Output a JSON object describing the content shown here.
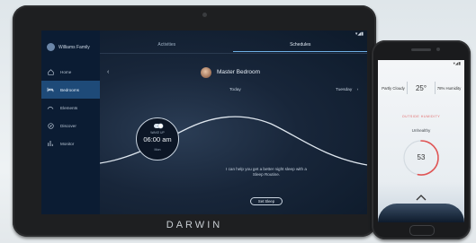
{
  "tablet": {
    "brand": "DARWIN",
    "status": "▾◢▮",
    "sidebar": {
      "profile_name": "Williams Family",
      "items": [
        {
          "label": "Home",
          "icon": "home-icon"
        },
        {
          "label": "Bedrooms",
          "icon": "bed-icon",
          "active": true
        },
        {
          "label": "Elements",
          "icon": "elements-icon"
        },
        {
          "label": "Discover",
          "icon": "discover-icon"
        },
        {
          "label": "Monitor",
          "icon": "monitor-icon"
        }
      ]
    },
    "tabs": [
      {
        "label": "Activities",
        "active": false
      },
      {
        "label": "Schedules",
        "active": true
      }
    ],
    "back_glyph": "‹",
    "room_title": "Master Bedroom",
    "today_label": "Today",
    "next_day_label": "Tuesday",
    "next_day_arrow": "›",
    "alarm": {
      "label": "WAKE UP",
      "time": "06:00 am",
      "day": "Mon"
    },
    "message": "I can help you get a better night sleep with a Sleep Routine.",
    "set_sleep_label": "Set Sleep",
    "accent_color": "#6fb0e6",
    "active_nav_color": "#1e4a78"
  },
  "phone": {
    "status": "▾◢▮",
    "stats": [
      {
        "label": "Partly Cloudy"
      },
      {
        "label": "25°"
      },
      {
        "label": "78% Humidity"
      }
    ],
    "outside_label": "OUTSIDE HUMIDITY",
    "humidity_title": "Unhealthy",
    "gauge": {
      "value": "53",
      "fraction": 0.53,
      "color": "#e05656"
    },
    "chevron": "up-chevron-icon"
  }
}
